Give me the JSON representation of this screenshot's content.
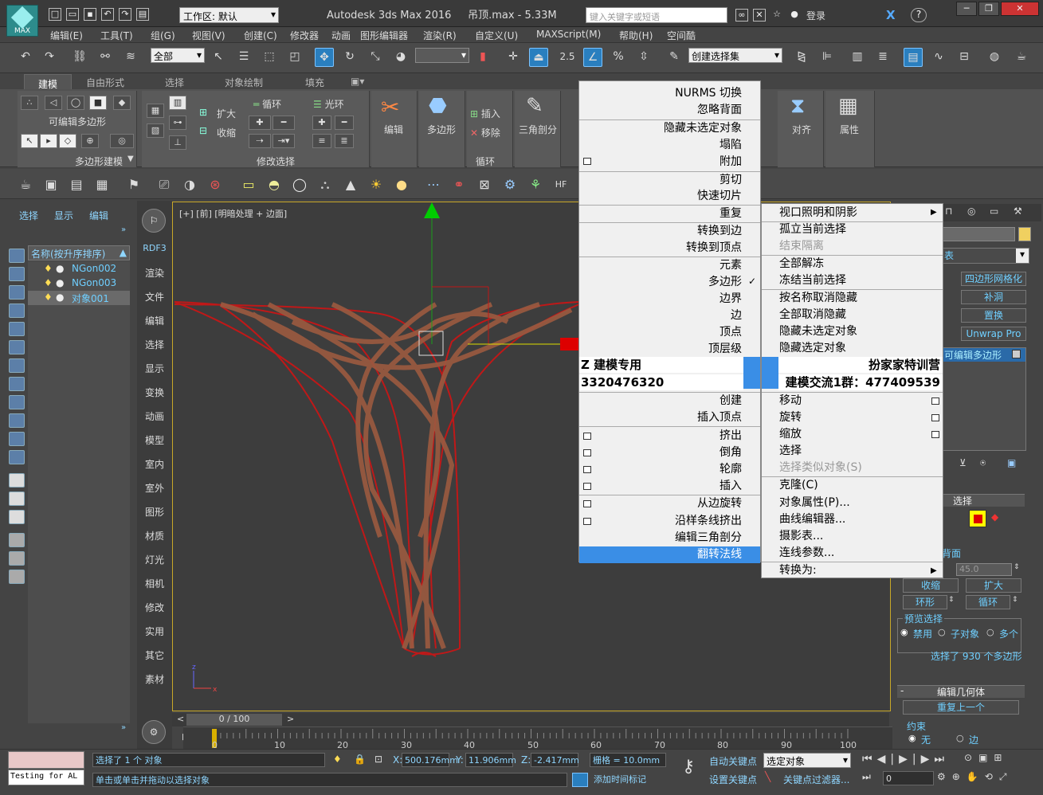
{
  "app": {
    "title": "Autodesk 3ds Max 2016",
    "file": "吊顶.max - 5.33M",
    "logo": "MAX",
    "workspace": "工作区: 默认",
    "search_placeholder": "键入关键字或短语",
    "login": "登录"
  },
  "menu": [
    "编辑(E)",
    "工具(T)",
    "组(G)",
    "视图(V)",
    "创建(C)",
    "修改器",
    "动画",
    "图形编辑器",
    "渲染(R)",
    "自定义(U)",
    "MAXScript(M)",
    "帮助(H)",
    "空间酷"
  ],
  "toolbar": {
    "filter": "全部",
    "selset": "创建选择集",
    "snap_val": "2.5"
  },
  "ribbon": {
    "tabs": [
      "建模",
      "自由形式",
      "选择",
      "对象绘制",
      "填充"
    ],
    "editable_poly": "可编辑多边形",
    "polymodel": "多边形建模",
    "modsel": "修改选择",
    "expand": "扩大",
    "shrink": "收缩",
    "loop": "循环",
    "ring": "光环",
    "edit": "编辑",
    "poly": "多边形",
    "insert": "插入",
    "remove": "移除",
    "tri": "三角剖分",
    "loop2": "循环",
    "align": "对齐",
    "props": "属性"
  },
  "left": {
    "tabs": [
      "选择",
      "显示",
      "编辑"
    ],
    "header": "名称(按升序排序)",
    "items": [
      "NGon002",
      "NGon003",
      "对象001"
    ]
  },
  "vbar": [
    "RDF3",
    "渲染",
    "文件",
    "编辑",
    "选择",
    "显示",
    "变换",
    "动画",
    "模型",
    "室内",
    "室外",
    "图形",
    "材质",
    "灯光",
    "相机",
    "修改",
    "实用",
    "其它",
    "素材"
  ],
  "viewport": {
    "label": "[+] [前] [明暗处理 + 边面]"
  },
  "ctx_left": [
    "NURMS 切换",
    "忽略背面",
    "隐藏未选定对象",
    "塌陷",
    "附加",
    "剪切",
    "快速切片",
    "重复",
    "转换到边",
    "转换到顶点",
    "元素",
    "多边形",
    "边界",
    "边",
    "顶点",
    "顶层级",
    "Z 建模专用",
    "3320476320",
    "创建",
    "插入顶点",
    "挤出",
    "倒角",
    "轮廓",
    "插入",
    "从边旋转",
    "沿样条线挤出",
    "编辑三角剖分",
    "翻转法线"
  ],
  "ctx_right": [
    "视口照明和阴影",
    "孤立当前选择",
    "结束隔离",
    "全部解冻",
    "冻结当前选择",
    "按名称取消隐藏",
    "全部取消隐藏",
    "隐藏未选定对象",
    "隐藏选定对象",
    "扮家家特训营",
    "建模交流1群：477409539",
    "移动",
    "旋转",
    "缩放",
    "选择",
    "选择类似对象(S)",
    "克隆(C)",
    "对象属性(P)...",
    "曲线编辑器...",
    "摄影表...",
    "连线参数...",
    "转换为:"
  ],
  "cmd": {
    "b1": "四边形网格化",
    "b2": "补洞",
    "b3": "置换",
    "b4": "Unwrap Pro",
    "stack": "可编辑多边形",
    "sel": "选择",
    "angle": "45.0",
    "shrink": "收缩",
    "grow": "扩大",
    "ring": "环形",
    "loop": "循环",
    "preview": "预览选择",
    "off": "禁用",
    "sub": "子对象",
    "multi": "多个",
    "count": "选择了 930 个多边形",
    "geom": "编辑几何体",
    "repeat": "重复上一个",
    "constraint": "约束",
    "none": "无",
    "edge": "边",
    "face_label": "背面",
    "tbl": "表"
  },
  "timeline": {
    "frame": "0 / 100",
    "ticks": [
      "0",
      "10",
      "20",
      "30",
      "40",
      "50",
      "60",
      "70",
      "80",
      "90",
      "100"
    ]
  },
  "status": {
    "selected": "选择了 1 个 对象",
    "hint": "单击或单击并拖动以选择对象",
    "x": "500.176mm",
    "y": "11.906mm",
    "z": "-2.417mm",
    "grid": "栅格 = 10.0mm",
    "autokey": "自动关键点",
    "setkey": "设置关键点",
    "selobj": "选定对象",
    "addtime": "添加时间标记",
    "keyfilter": "关键点过滤器...",
    "testing": "Testing for AL",
    "frame0": "0",
    "xl": "X:",
    "yl": "Y:",
    "zl": "Z:"
  }
}
